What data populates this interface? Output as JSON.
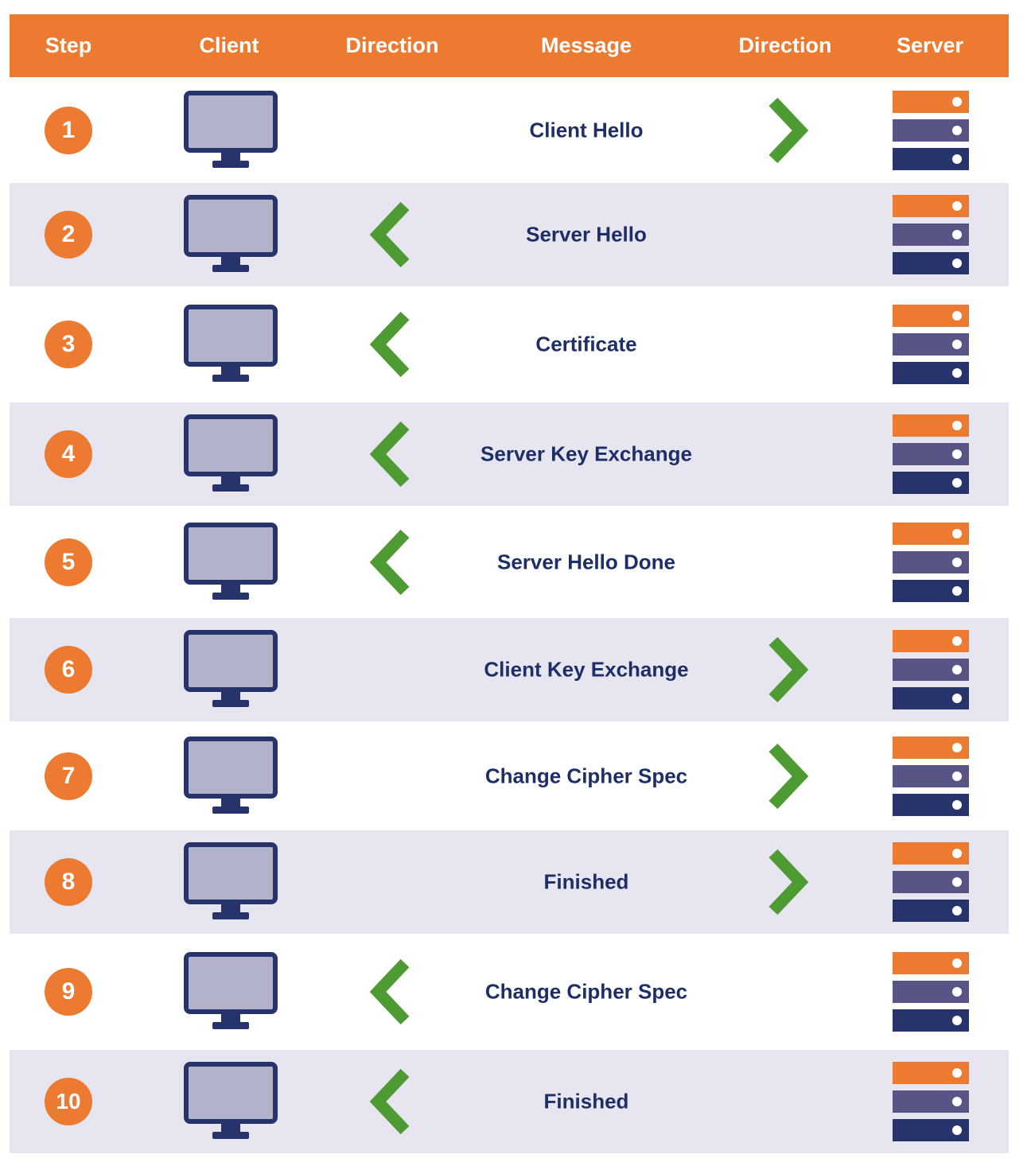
{
  "header": {
    "step": "Step",
    "client": "Client",
    "direction_left": "Direction",
    "message": "Message",
    "direction_right": "Direction",
    "server": "Server"
  },
  "colors": {
    "header_bg": "#ec7a31",
    "shaded_row": "#e7e6f0",
    "step_circle": "#ec7a31",
    "message_text": "#1e2f68",
    "arrow": "#4e9b33",
    "monitor_frame": "#26346b",
    "monitor_screen": "#b3b2cb",
    "server_top": "#ec7a31",
    "server_middle": "#585486",
    "server_bottom": "#26346b"
  },
  "rows": [
    {
      "step": "1",
      "message": "Client Hello",
      "direction": "client-to-server"
    },
    {
      "step": "2",
      "message": "Server Hello",
      "direction": "server-to-client"
    },
    {
      "step": "3",
      "message": "Certificate",
      "direction": "server-to-client"
    },
    {
      "step": "4",
      "message": "Server Key Exchange",
      "direction": "server-to-client"
    },
    {
      "step": "5",
      "message": "Server Hello Done",
      "direction": "server-to-client"
    },
    {
      "step": "6",
      "message": "Client Key Exchange",
      "direction": "client-to-server"
    },
    {
      "step": "7",
      "message": "Change Cipher Spec",
      "direction": "client-to-server"
    },
    {
      "step": "8",
      "message": "Finished",
      "direction": "client-to-server"
    },
    {
      "step": "9",
      "message": "Change Cipher Spec",
      "direction": "server-to-client"
    },
    {
      "step": "10",
      "message": "Finished",
      "direction": "server-to-client"
    }
  ]
}
